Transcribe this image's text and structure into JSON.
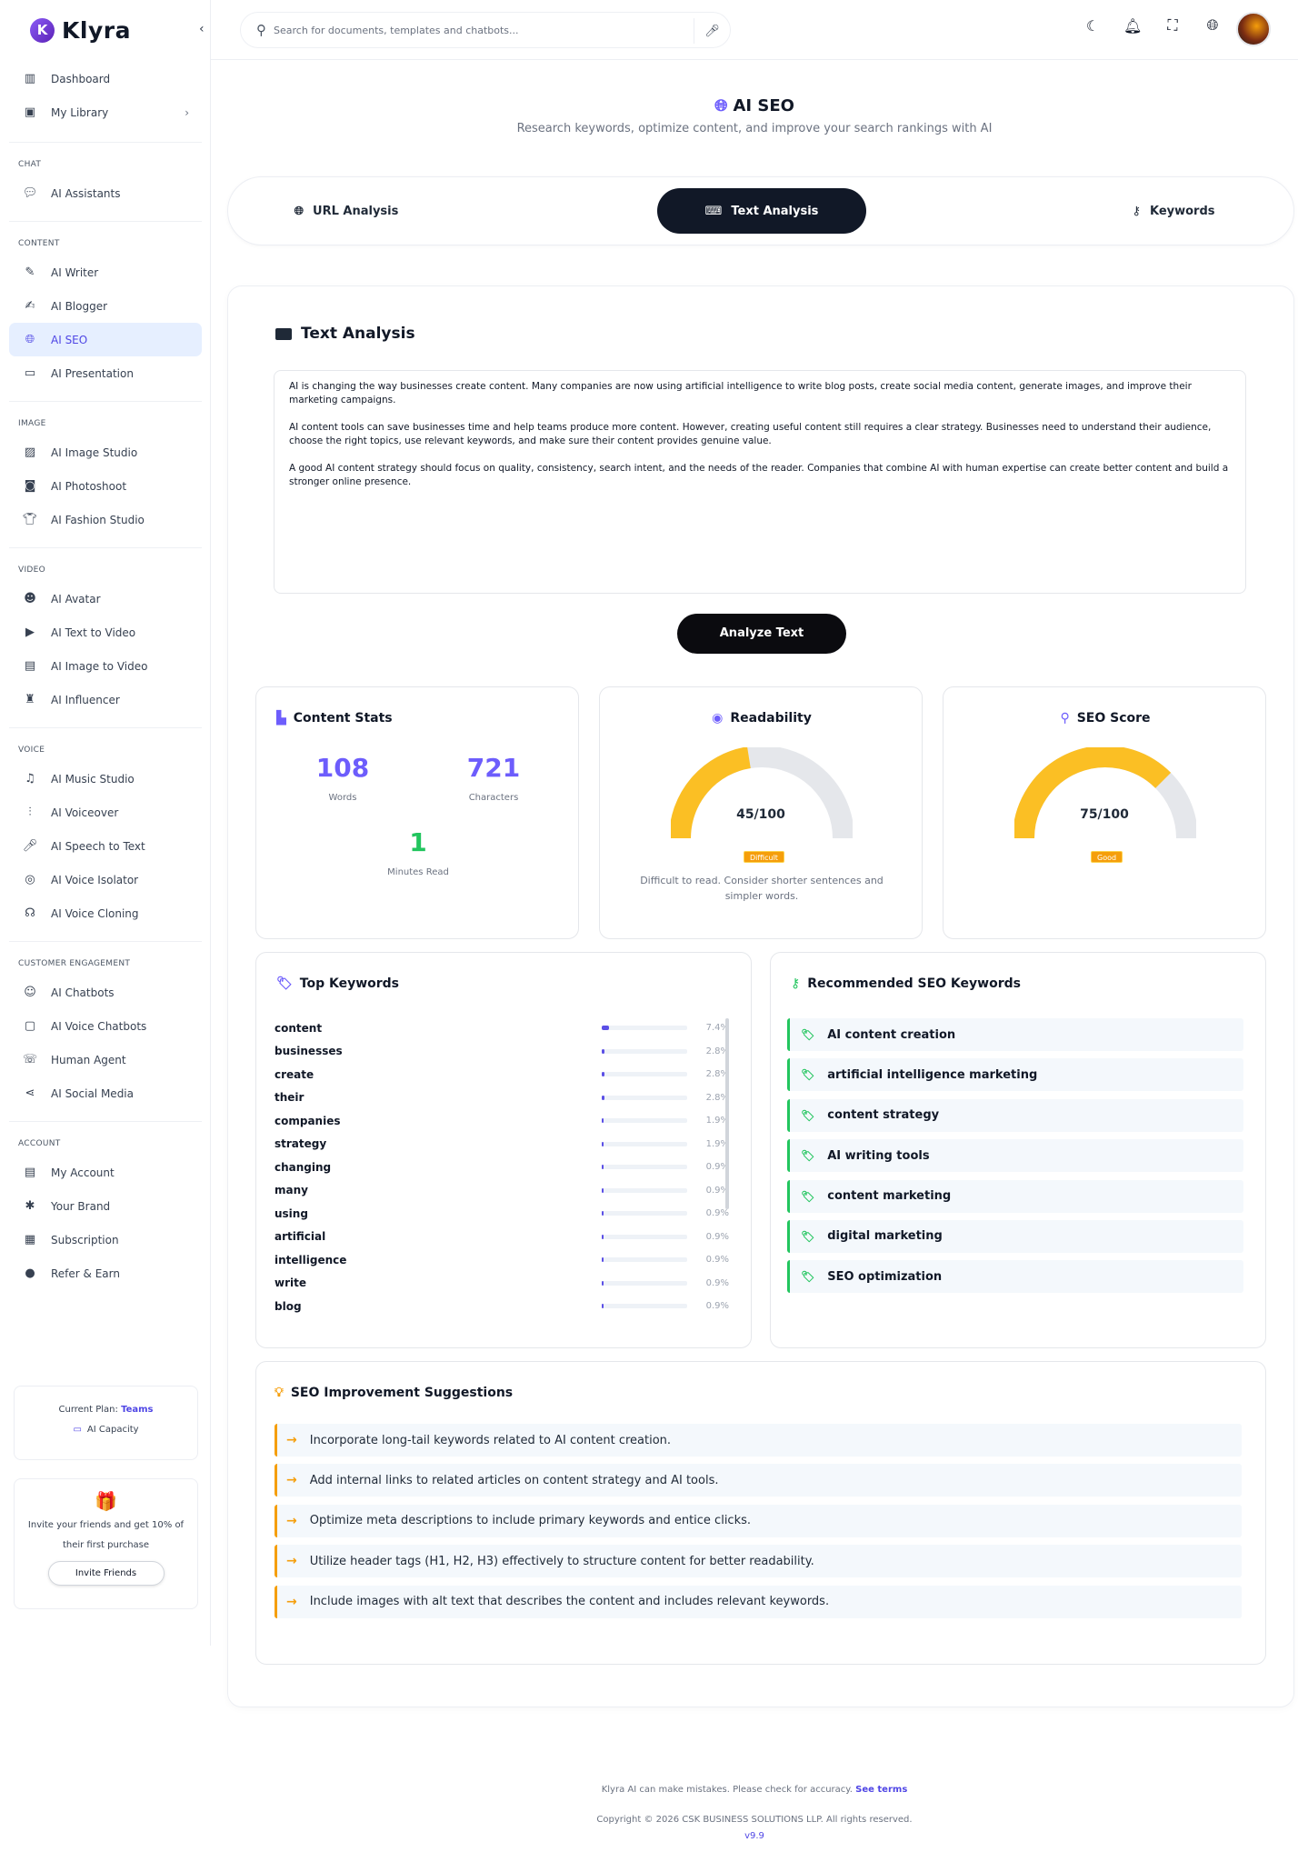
{
  "brand": {
    "name": "Klyra"
  },
  "sidebar": {
    "sections": [
      {
        "title": "",
        "items": [
          {
            "label": "Dashboard",
            "icon": "map-icon"
          },
          {
            "label": "My Library",
            "icon": "folder-plus-icon",
            "chevron": true
          }
        ]
      },
      {
        "title": "CHAT",
        "items": [
          {
            "label": "AI Assistants",
            "icon": "chat-icon"
          }
        ]
      },
      {
        "title": "CONTENT",
        "items": [
          {
            "label": "AI Writer",
            "icon": "pen-icon"
          },
          {
            "label": "AI Blogger",
            "icon": "blog-icon"
          },
          {
            "label": "AI SEO",
            "icon": "globe-icon",
            "active": true
          },
          {
            "label": "AI Presentation",
            "icon": "presentation-icon"
          }
        ]
      },
      {
        "title": "IMAGE",
        "items": [
          {
            "label": "AI Image Studio",
            "icon": "image-icon"
          },
          {
            "label": "AI Photoshoot",
            "icon": "camera-icon"
          },
          {
            "label": "AI Fashion Studio",
            "icon": "shirt-icon"
          }
        ]
      },
      {
        "title": "VIDEO",
        "items": [
          {
            "label": "AI Avatar",
            "icon": "mask-icon"
          },
          {
            "label": "AI Text to Video",
            "icon": "video-icon"
          },
          {
            "label": "AI Image to Video",
            "icon": "file-video-icon"
          },
          {
            "label": "AI Influencer",
            "icon": "person-icon"
          }
        ]
      },
      {
        "title": "VOICE",
        "items": [
          {
            "label": "AI Music Studio",
            "icon": "music-icon"
          },
          {
            "label": "AI Voiceover",
            "icon": "waveform-icon"
          },
          {
            "label": "AI Speech to Text",
            "icon": "microphone-icon"
          },
          {
            "label": "AI Voice Isolator",
            "icon": "target-icon"
          },
          {
            "label": "AI Voice Cloning",
            "icon": "user-voice-icon"
          }
        ]
      },
      {
        "title": "CUSTOMER ENGAGEMENT",
        "items": [
          {
            "label": "AI Chatbots",
            "icon": "robot-icon"
          },
          {
            "label": "AI Voice Chatbots",
            "icon": "monitor-icon"
          },
          {
            "label": "Human Agent",
            "icon": "headset-icon"
          },
          {
            "label": "AI Social Media",
            "icon": "share-icon"
          }
        ]
      },
      {
        "title": "ACCOUNT",
        "items": [
          {
            "label": "My Account",
            "icon": "id-card-icon"
          },
          {
            "label": "Your Brand",
            "icon": "brand-icon"
          },
          {
            "label": "Subscription",
            "icon": "cart-icon"
          },
          {
            "label": "Refer & Earn",
            "icon": "coin-icon"
          }
        ]
      }
    ],
    "plan": {
      "prefix": "Current Plan:",
      "name": "Teams",
      "capacity": "AI Capacity"
    },
    "invite": {
      "text": "Invite your friends and get 10% of their first purchase",
      "button": "Invite Friends"
    }
  },
  "header": {
    "search_placeholder": "Search for documents, templates and chatbots..."
  },
  "page": {
    "title": "AI SEO",
    "subtitle": "Research keywords, optimize content, and improve your search rankings with AI",
    "tabs": [
      {
        "label": "URL Analysis",
        "icon": "globe-icon"
      },
      {
        "label": "Text Analysis",
        "icon": "keyboard-icon",
        "active": true
      },
      {
        "label": "Keywords",
        "icon": "key-icon"
      }
    ]
  },
  "analysis": {
    "heading": "Text Analysis",
    "text": "AI is changing the way businesses create content. Many companies are now using artificial intelligence to write blog posts, create social media content, generate images, and improve their marketing campaigns.\n\nAI content tools can save businesses time and help teams produce more content. However, creating useful content still requires a clear strategy. Businesses need to understand their audience, choose the right topics, use relevant keywords, and make sure their content provides genuine value.\n\nA good AI content strategy should focus on quality, consistency, search intent, and the needs of the reader. Companies that combine AI with human expertise can create better content and build a stronger online presence.",
    "button": "Analyze Text"
  },
  "stats": {
    "title": "Content Stats",
    "words": "108",
    "words_label": "Words",
    "characters": "721",
    "characters_label": "Characters",
    "minutes": "1",
    "minutes_label": "Minutes Read"
  },
  "readability": {
    "title": "Readability",
    "score": 45,
    "score_text": "45/100",
    "badge": "Difficult",
    "note": "Difficult to read. Consider shorter sentences and simpler words."
  },
  "seo_score": {
    "title": "SEO Score",
    "score": 75,
    "score_text": "75/100",
    "badge": "Good"
  },
  "colors": {
    "accent": "#6d5dfc",
    "gauge": "#fbbf24",
    "gauge_track": "#e5e7eb",
    "badge": "#f59e0b",
    "green": "#22c55e"
  },
  "top_keywords": {
    "title": "Top Keywords",
    "items": [
      {
        "word": "content",
        "pct": "7.4%",
        "value": 7.4
      },
      {
        "word": "businesses",
        "pct": "2.8%",
        "value": 2.8
      },
      {
        "word": "create",
        "pct": "2.8%",
        "value": 2.8
      },
      {
        "word": "their",
        "pct": "2.8%",
        "value": 2.8
      },
      {
        "word": "companies",
        "pct": "1.9%",
        "value": 1.9
      },
      {
        "word": "strategy",
        "pct": "1.9%",
        "value": 1.9
      },
      {
        "word": "changing",
        "pct": "0.9%",
        "value": 0.9
      },
      {
        "word": "many",
        "pct": "0.9%",
        "value": 0.9
      },
      {
        "word": "using",
        "pct": "0.9%",
        "value": 0.9
      },
      {
        "word": "artificial",
        "pct": "0.9%",
        "value": 0.9
      },
      {
        "word": "intelligence",
        "pct": "0.9%",
        "value": 0.9
      },
      {
        "word": "write",
        "pct": "0.9%",
        "value": 0.9
      },
      {
        "word": "blog",
        "pct": "0.9%",
        "value": 0.9
      }
    ]
  },
  "recommended": {
    "title": "Recommended SEO Keywords",
    "items": [
      "AI content creation",
      "artificial intelligence marketing",
      "content strategy",
      "AI writing tools",
      "content marketing",
      "digital marketing",
      "SEO optimization"
    ]
  },
  "suggestions": {
    "title": "SEO Improvement Suggestions",
    "items": [
      "Incorporate long-tail keywords related to AI content creation.",
      "Add internal links to related articles on content strategy and AI tools.",
      "Optimize meta descriptions to include primary keywords and entice clicks.",
      "Utilize header tags (H1, H2, H3) effectively to structure content for better readability.",
      "Include images with alt text that describes the content and includes relevant keywords."
    ]
  },
  "footer": {
    "disclaimer": "Klyra AI can make mistakes. Please check for accuracy.",
    "terms": "See terms",
    "copyright": "Copyright © 2026 CSK BUSINESS SOLUTIONS LLP. All rights reserved.",
    "version": "v9.9"
  }
}
